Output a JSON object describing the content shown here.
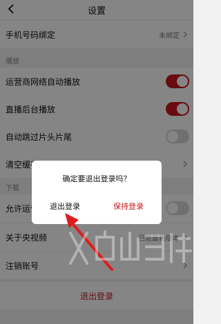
{
  "header": {
    "title": "设置",
    "back_icon": "chevron-left-icon"
  },
  "rows": {
    "phone_binding": {
      "label": "手机号码绑定",
      "value": "未绑定"
    },
    "carrier_autoplay": {
      "label": "运营商网络自动播放",
      "toggle": true
    },
    "background_play": {
      "label": "直播后台播放",
      "toggle": true
    },
    "skip_intro": {
      "label": "自动跳过片头片尾",
      "toggle": false
    },
    "clear_cache": {
      "label": "清空缓存"
    },
    "allow_download": {
      "label": "允许运营",
      "toggle": false
    },
    "about": {
      "label": "关于央视频",
      "value": "已是最新版本"
    },
    "cancel_account": {
      "label": "注销账号"
    }
  },
  "sections": {
    "playback": "播放",
    "download": "下载"
  },
  "logout": {
    "label": "退出登录"
  },
  "dialog": {
    "message": "确定要退出登录吗？",
    "confirm_label": "退出登录",
    "keep_label": "保持登录"
  },
  "colors": {
    "accent": "#c8181e",
    "toggle_off": "#d6d6d6"
  }
}
